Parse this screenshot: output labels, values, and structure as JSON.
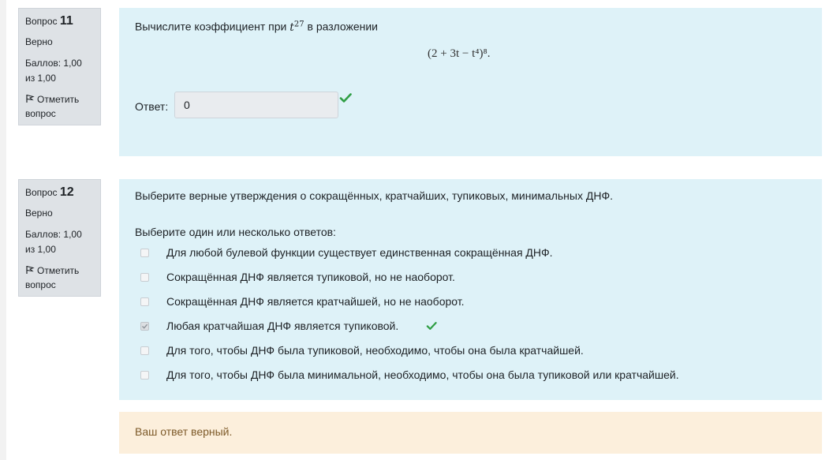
{
  "q11": {
    "label": "Вопрос",
    "number": "11",
    "state": "Верно",
    "grade": "Баллов: 1,00 из 1,00",
    "flag": "Отметить вопрос",
    "text_before": "Вычислите коэффициент при",
    "var": "t",
    "exponent": "27",
    "text_after": "в разложении",
    "expression": "(2 + 3t − t⁴)⁸.",
    "answer_label": "Ответ:",
    "answer_value": "0",
    "status_color": "#2f9e44"
  },
  "q12": {
    "label": "Вопрос",
    "number": "12",
    "state": "Верно",
    "grade": "Баллов: 1,00 из 1,00",
    "flag": "Отметить вопрос",
    "question": "Выберите верные утверждения о сокращённых, кратчайших, тупиковых, минимальных ДНФ.",
    "prompt": "Выберите один или несколько ответов:",
    "options": [
      {
        "text": "Для любой булевой функции существует единственная сокращённая ДНФ.",
        "checked": false
      },
      {
        "text": "Сокращённая ДНФ является тупиковой, но не наоборот.",
        "checked": false
      },
      {
        "text": "Сокращённая ДНФ является кратчайшей, но не наоборот.",
        "checked": false
      },
      {
        "text": "Любая кратчайшая ДНФ является тупиковой.",
        "checked": true
      },
      {
        "text": "Для того, чтобы ДНФ была тупиковой, необходимо, чтобы она была кратчайшей.",
        "checked": false
      },
      {
        "text": "Для того, чтобы ДНФ была минимальной, необходимо, чтобы она была тупиковой или кратчайшей.",
        "checked": false
      }
    ],
    "feedback": "Ваш ответ верный."
  },
  "colors": {
    "panel": "#def2f8",
    "info_box": "#dee2e6",
    "feedback_bg": "#fcefdc",
    "feedback_text": "#7d5a29",
    "correct": "#2f9e44"
  }
}
